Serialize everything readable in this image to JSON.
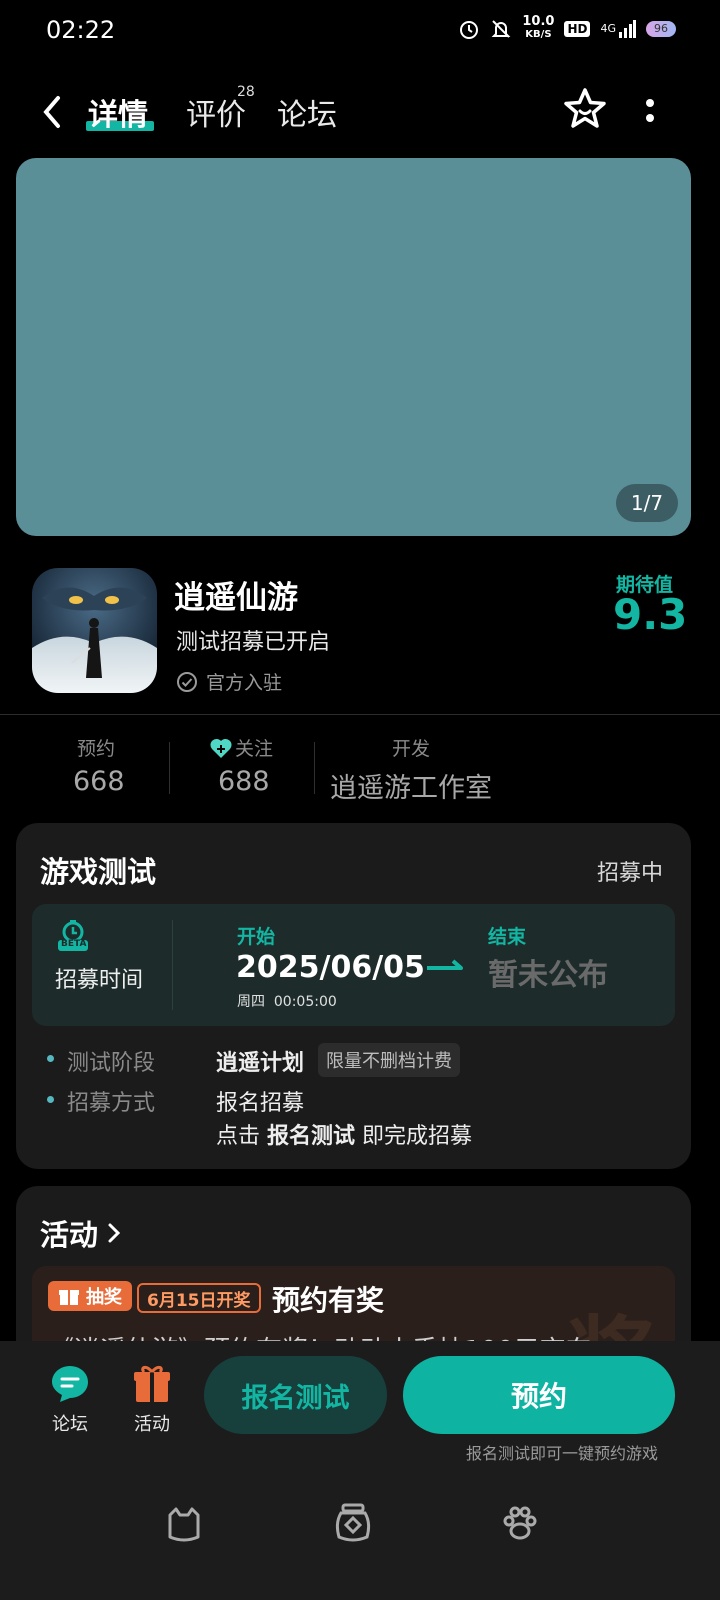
{
  "status": {
    "time": "02:22",
    "net_speed": "10.0",
    "net_unit": "KB/S",
    "hd": "HD",
    "network": "4G",
    "battery": "96"
  },
  "header": {
    "tabs": [
      {
        "label": "详情"
      },
      {
        "label": "评价",
        "badge": "28"
      },
      {
        "label": "论坛"
      }
    ]
  },
  "hero": {
    "counter": "1/7"
  },
  "app": {
    "name": "逍遥仙游",
    "subtitle": "测试招募已开启",
    "official": "官方入驻",
    "expect_label": "期待值",
    "expect_value": "9.3"
  },
  "stats": [
    {
      "label": "预约",
      "value": "668"
    },
    {
      "label": "关注",
      "value": "688"
    },
    {
      "label": "开发",
      "value": "逍遥游工作室"
    }
  ],
  "game_test": {
    "title": "游戏测试",
    "status": "招募中",
    "recruit_label": "招募时间",
    "beta": "BETA",
    "start_label": "开始",
    "start_date": "2025/06/05",
    "start_time": "周四  00:05:00",
    "end_label": "结束",
    "end_value": "暂未公布",
    "stage_label": "测试阶段",
    "stage_value": "逍遥计划",
    "stage_tag": "限量不删档计费",
    "method_label": "招募方式",
    "method_value": "报名招募",
    "method_desc_1": "点击 ",
    "method_desc_bold": "报名测试",
    "method_desc_2": " 即完成招募"
  },
  "activity": {
    "title": "活动",
    "badge": "抽奖",
    "date_tag": "6月15日开奖",
    "item_title": "预约有奖",
    "item_desc": "《逍遥仙游》预约有奖！动动小手抽100元京东"
  },
  "action_bar": {
    "forum_label": "论坛",
    "activity_label": "活动",
    "test_button": "报名测试",
    "book_button": "预约",
    "hint": "报名测试即可一键预约游戏"
  },
  "colors": {
    "accent": "#12b6a3",
    "hero": "#5b8f98",
    "orange": "#e86b3a"
  }
}
